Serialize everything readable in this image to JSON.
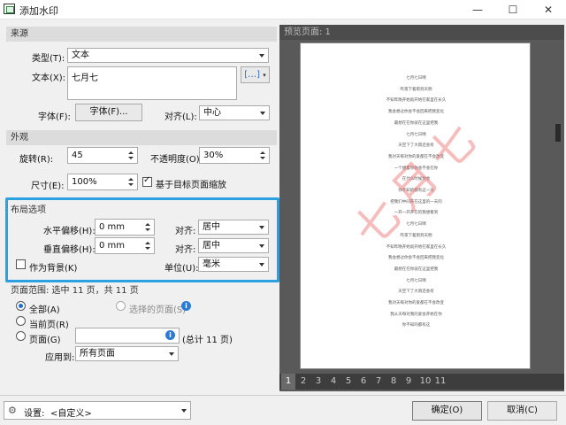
{
  "window": {
    "title": "添加水印",
    "minimize": "—",
    "maximize": "☐",
    "close": "✕"
  },
  "source": {
    "header": "来源",
    "type_label": "类型(T):",
    "type_value": "文本",
    "text_label": "文本(X):",
    "text_value": "七月七",
    "insert_btn": "[…]",
    "font_label": "字体(F):",
    "font_btn": "字体(F)...",
    "align_label": "对齐(L):",
    "align_value": "中心"
  },
  "appearance": {
    "header": "外观",
    "rotate_label": "旋转(R):",
    "rotate_value": "45",
    "opacity_label": "不透明度(O):",
    "opacity_value": "30%",
    "size_label": "尺寸(E):",
    "size_value": "100%",
    "scale_checked": true,
    "scale_label": "基于目标页面缩放"
  },
  "layout": {
    "header": "布局选项",
    "h_offset_label": "水平偏移(H):",
    "h_offset_value": "0 mm",
    "h_align_label": "对齐:",
    "h_align_value": "居中",
    "v_offset_label": "垂直偏移(H):",
    "v_offset_value": "0 mm",
    "v_align_label": "对齐:",
    "v_align_value": "居中",
    "background_checked": false,
    "background_label": "作为背景(K)",
    "unit_label": "单位(U):",
    "unit_value": "毫米"
  },
  "page_range": {
    "header": "页面范围: 选中 11 页，共 11 页",
    "all_label": "全部(A)",
    "all_selected": true,
    "selected_pages_label": "选择的页面(S)",
    "current_label": "当前页(R)",
    "pages_label": "页面(G)",
    "pages_value": "",
    "total_label": "(总计 11 页)",
    "apply_label": "应用到:",
    "apply_value": "所有页面"
  },
  "preview": {
    "header": "预览页面: 1",
    "watermark": "七月七",
    "lines": [
      "七月七日晴",
      "昨夜下着雨到天明",
      "不知昨晚开始就开始在家里在长久",
      "我会想过你会不会回来把我变化",
      "最想在在你就在这里把我",
      "七月七日晴",
      "天空下了大雨还会有",
      "我对天每对你的爱都在不会改变",
      "一个想着你你会不会在你",
      "在什么时候你会",
      "你不知的都有这一天",
      "把我们中间开在这里的一天的",
      "一开一开开在的我想看到",
      "七月七日晴",
      "昨夜下着雨到天明",
      "不知昨晚开始就开始在家里在长久",
      "我会想过你会不会回来把我变化",
      "最想在在你就在这里把我",
      "七月七日晴",
      "天空下了大雨还会有",
      "我对天每对你的爱都在不会改变",
      "我从天每对我的爱会开始在你",
      "你不知的都有这"
    ],
    "pages": [
      "1",
      "2",
      "3",
      "4",
      "5",
      "6",
      "7",
      "8",
      "9",
      "10",
      "11"
    ],
    "active_page": "1"
  },
  "footer": {
    "settings_label": "设置:",
    "settings_value": "<自定义>",
    "ok_btn": "确定(O)",
    "cancel_btn": "取消(C)"
  },
  "colors": {
    "highlight": "#2da1e0",
    "watermark": "#ee6c6c",
    "radio": "#1a6fd6"
  }
}
